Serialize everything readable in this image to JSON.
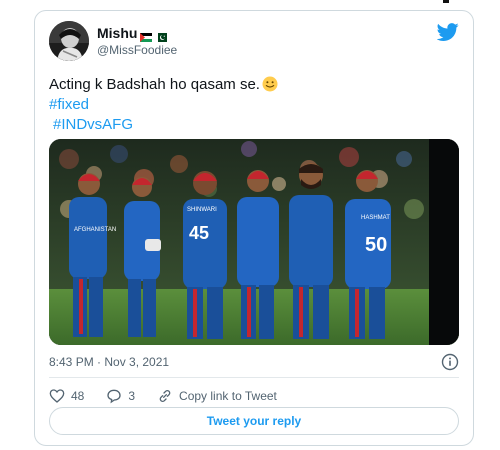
{
  "user": {
    "display_name": "Mishu",
    "handle": "@MissFoodiee",
    "flags": [
      "palestine-flag",
      "pakistan-flag"
    ]
  },
  "tweet": {
    "text_main": "Acting k Badshah ho qasam se.",
    "emoji": "slightly-smiling-face",
    "hashtag_1": "#fixed",
    "hashtag_2": "#INDvsAFG",
    "jersey_numbers": [
      "45",
      "50"
    ],
    "jersey_names": [
      "AFGHANISTAN",
      "SHINWARI",
      "HASHMAT"
    ]
  },
  "meta": {
    "timestamp": "8:43 PM · Nov 3, 2021"
  },
  "actions": {
    "like_count": "48",
    "reply_count": "3",
    "copy_link_label": "Copy link to Tweet"
  },
  "reply": {
    "button_label": "Tweet your reply"
  },
  "colors": {
    "accent": "#1d9bf0",
    "jersey_blue": "#1f5fb4",
    "jersey_red": "#c4262e"
  }
}
